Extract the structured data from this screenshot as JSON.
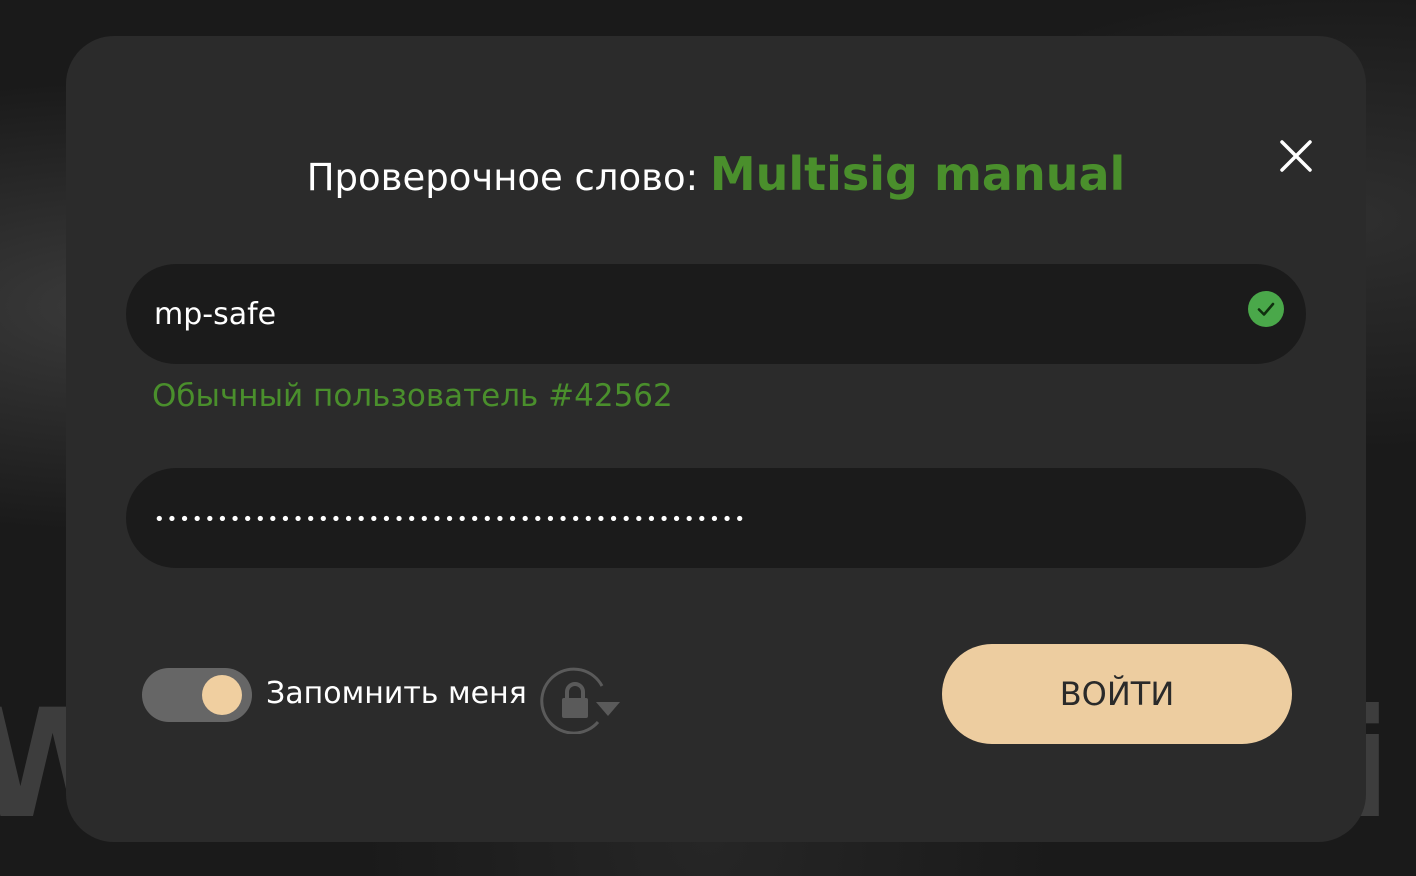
{
  "modal": {
    "title_prefix": "Проверочное слово:",
    "title_accent": "Multisig manual",
    "accent_color": "#4a8f2c"
  },
  "login_field": {
    "value": "mp-safe",
    "status_icon": "check-circle-icon",
    "status_color": "#4aa84a"
  },
  "user_label": "Обычный пользователь #42562",
  "password_field": {
    "masked_value": "•••••••••••••••••••••••••••••••••••••••••••••••"
  },
  "remember": {
    "label": "Запомнить меня",
    "enabled": true,
    "icon": "lock-rotate-icon"
  },
  "submit": {
    "label": "ВОЙТИ",
    "color": "#edcda0"
  },
  "close": {
    "icon": "close-icon"
  },
  "background": {
    "left_text": "W",
    "right_text": "i"
  }
}
